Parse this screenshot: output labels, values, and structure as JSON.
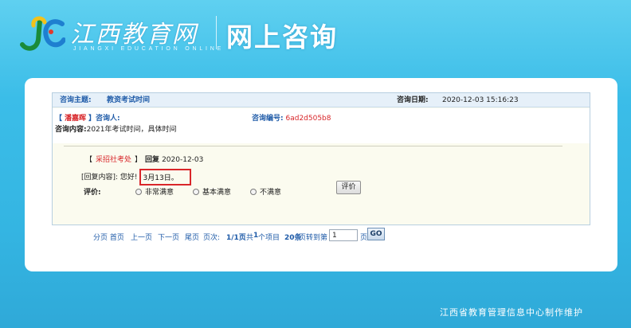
{
  "header": {
    "logo_cn": "江西教育网",
    "logo_en": "JIANGXI EDUCATION ONLINE",
    "page_title": "网上咨询"
  },
  "consult": {
    "topic_label": "咨询主题:",
    "topic_value": "教资考试时间",
    "date_label": "咨询日期:",
    "date_value": "2020-12-03 15:16:23",
    "asker_open": "【",
    "asker_name": "潘嘉晖",
    "asker_close": "】咨询人:",
    "qno_label": "咨询编号:",
    "qno_value": "6ad2d505b8",
    "content_label": "咨询内容:",
    "content_value": "2021年考试时间，具体时间"
  },
  "reply": {
    "open": "【",
    "dept": "采招社考处",
    "close": "】",
    "keyword": "回复",
    "date": "2020-12-03",
    "content_label": "[回复内容]: 您好!",
    "answer": "3月13日。"
  },
  "rating": {
    "label": "评价:",
    "options": [
      "非常满意",
      "基本满意",
      "不满意"
    ],
    "button": "评价"
  },
  "pager": {
    "first": "分页 首页",
    "prev": "上一页",
    "next": "下一页",
    "last": "尾页",
    "pages_label": "页次:",
    "pages_value": "1/1页",
    "total_prefix": "共",
    "total_count": "1",
    "total_suffix": "个项目",
    "per_page": "20条",
    "per_suffix": "页转到第",
    "input_value": "1",
    "page_suffix": "页",
    "go": "GO"
  },
  "footer": {
    "text": "江西省教育管理信息中心制作维护"
  },
  "colors": {
    "background": "#34b5e2",
    "link_blue": "#1f5ba8",
    "highlight_red": "#d9262a"
  }
}
